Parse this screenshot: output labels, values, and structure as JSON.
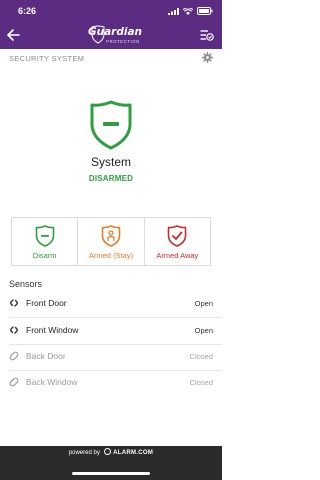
{
  "status_bar": {
    "time": "6:26"
  },
  "header": {
    "logo_text": "Guardian",
    "logo_subtext": "PROTECTION",
    "back_icon": "arrow-left-icon",
    "menu_icon": "menu-list-icon"
  },
  "section": {
    "title": "SECURITY SYSTEM",
    "settings_icon": "gear-icon"
  },
  "system": {
    "title": "System",
    "status": "DISARMED",
    "status_color": "#2f9e3e"
  },
  "actions": [
    {
      "label": "Disarm",
      "icon": "shield-disarm-icon",
      "color": "#2f9e3e"
    },
    {
      "label": "Armed (Stay)",
      "icon": "shield-stay-icon",
      "color": "#e57c28"
    },
    {
      "label": "Armed Away",
      "icon": "shield-away-icon",
      "color": "#c62d2d"
    }
  ],
  "sensors": {
    "title": "Sensors",
    "items": [
      {
        "name": "Front Door",
        "status": "Open",
        "active": true,
        "icon": "sensor-open-icon"
      },
      {
        "name": "Front Window",
        "status": "Open",
        "active": true,
        "icon": "sensor-open-icon"
      },
      {
        "name": "Back Door",
        "status": "Closed",
        "active": false,
        "icon": "sensor-closed-icon"
      },
      {
        "name": "Back Window",
        "status": "Closed",
        "active": false,
        "icon": "sensor-closed-icon"
      }
    ]
  },
  "footer": {
    "powered_by": "powered by",
    "brand": "ALARM.COM"
  },
  "colors": {
    "header": "#5b2c82",
    "footer": "#2b2b2b"
  }
}
